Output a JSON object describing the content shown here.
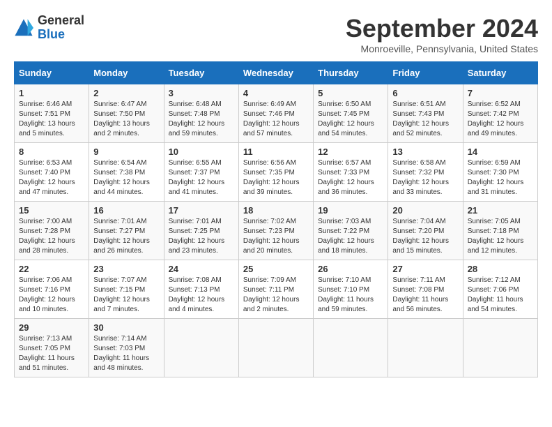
{
  "logo": {
    "general": "General",
    "blue": "Blue"
  },
  "header": {
    "month_title": "September 2024",
    "subtitle": "Monroeville, Pennsylvania, United States"
  },
  "weekdays": [
    "Sunday",
    "Monday",
    "Tuesday",
    "Wednesday",
    "Thursday",
    "Friday",
    "Saturday"
  ],
  "weeks": [
    [
      {
        "day": "1",
        "sunrise": "6:46 AM",
        "sunset": "7:51 PM",
        "daylight": "13 hours and 5 minutes."
      },
      {
        "day": "2",
        "sunrise": "6:47 AM",
        "sunset": "7:50 PM",
        "daylight": "13 hours and 2 minutes."
      },
      {
        "day": "3",
        "sunrise": "6:48 AM",
        "sunset": "7:48 PM",
        "daylight": "12 hours and 59 minutes."
      },
      {
        "day": "4",
        "sunrise": "6:49 AM",
        "sunset": "7:46 PM",
        "daylight": "12 hours and 57 minutes."
      },
      {
        "day": "5",
        "sunrise": "6:50 AM",
        "sunset": "7:45 PM",
        "daylight": "12 hours and 54 minutes."
      },
      {
        "day": "6",
        "sunrise": "6:51 AM",
        "sunset": "7:43 PM",
        "daylight": "12 hours and 52 minutes."
      },
      {
        "day": "7",
        "sunrise": "6:52 AM",
        "sunset": "7:42 PM",
        "daylight": "12 hours and 49 minutes."
      }
    ],
    [
      {
        "day": "8",
        "sunrise": "6:53 AM",
        "sunset": "7:40 PM",
        "daylight": "12 hours and 47 minutes."
      },
      {
        "day": "9",
        "sunrise": "6:54 AM",
        "sunset": "7:38 PM",
        "daylight": "12 hours and 44 minutes."
      },
      {
        "day": "10",
        "sunrise": "6:55 AM",
        "sunset": "7:37 PM",
        "daylight": "12 hours and 41 minutes."
      },
      {
        "day": "11",
        "sunrise": "6:56 AM",
        "sunset": "7:35 PM",
        "daylight": "12 hours and 39 minutes."
      },
      {
        "day": "12",
        "sunrise": "6:57 AM",
        "sunset": "7:33 PM",
        "daylight": "12 hours and 36 minutes."
      },
      {
        "day": "13",
        "sunrise": "6:58 AM",
        "sunset": "7:32 PM",
        "daylight": "12 hours and 33 minutes."
      },
      {
        "day": "14",
        "sunrise": "6:59 AM",
        "sunset": "7:30 PM",
        "daylight": "12 hours and 31 minutes."
      }
    ],
    [
      {
        "day": "15",
        "sunrise": "7:00 AM",
        "sunset": "7:28 PM",
        "daylight": "12 hours and 28 minutes."
      },
      {
        "day": "16",
        "sunrise": "7:01 AM",
        "sunset": "7:27 PM",
        "daylight": "12 hours and 26 minutes."
      },
      {
        "day": "17",
        "sunrise": "7:01 AM",
        "sunset": "7:25 PM",
        "daylight": "12 hours and 23 minutes."
      },
      {
        "day": "18",
        "sunrise": "7:02 AM",
        "sunset": "7:23 PM",
        "daylight": "12 hours and 20 minutes."
      },
      {
        "day": "19",
        "sunrise": "7:03 AM",
        "sunset": "7:22 PM",
        "daylight": "12 hours and 18 minutes."
      },
      {
        "day": "20",
        "sunrise": "7:04 AM",
        "sunset": "7:20 PM",
        "daylight": "12 hours and 15 minutes."
      },
      {
        "day": "21",
        "sunrise": "7:05 AM",
        "sunset": "7:18 PM",
        "daylight": "12 hours and 12 minutes."
      }
    ],
    [
      {
        "day": "22",
        "sunrise": "7:06 AM",
        "sunset": "7:16 PM",
        "daylight": "12 hours and 10 minutes."
      },
      {
        "day": "23",
        "sunrise": "7:07 AM",
        "sunset": "7:15 PM",
        "daylight": "12 hours and 7 minutes."
      },
      {
        "day": "24",
        "sunrise": "7:08 AM",
        "sunset": "7:13 PM",
        "daylight": "12 hours and 4 minutes."
      },
      {
        "day": "25",
        "sunrise": "7:09 AM",
        "sunset": "7:11 PM",
        "daylight": "12 hours and 2 minutes."
      },
      {
        "day": "26",
        "sunrise": "7:10 AM",
        "sunset": "7:10 PM",
        "daylight": "11 hours and 59 minutes."
      },
      {
        "day": "27",
        "sunrise": "7:11 AM",
        "sunset": "7:08 PM",
        "daylight": "11 hours and 56 minutes."
      },
      {
        "day": "28",
        "sunrise": "7:12 AM",
        "sunset": "7:06 PM",
        "daylight": "11 hours and 54 minutes."
      }
    ],
    [
      {
        "day": "29",
        "sunrise": "7:13 AM",
        "sunset": "7:05 PM",
        "daylight": "11 hours and 51 minutes."
      },
      {
        "day": "30",
        "sunrise": "7:14 AM",
        "sunset": "7:03 PM",
        "daylight": "11 hours and 48 minutes."
      },
      null,
      null,
      null,
      null,
      null
    ]
  ]
}
